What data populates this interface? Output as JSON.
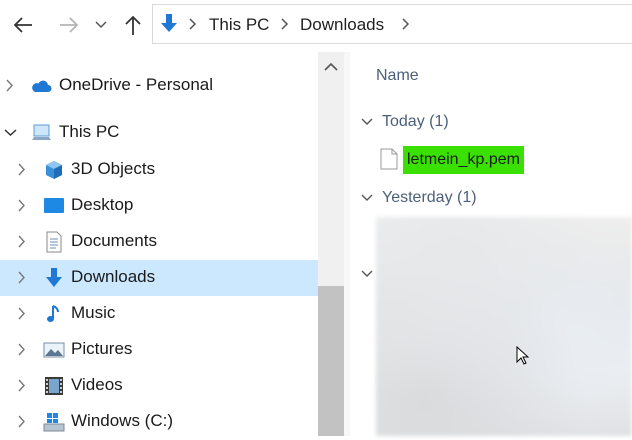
{
  "nav": {
    "back_icon": "arrow-left-icon",
    "forward_icon": "arrow-right-icon",
    "recent_icon": "chevron-down-icon",
    "up_icon": "arrow-up-icon"
  },
  "address": {
    "location_icon": "download-arrow-icon",
    "crumbs": [
      "This PC",
      "Downloads"
    ]
  },
  "tree": {
    "items": [
      {
        "label": "OneDrive - Personal",
        "icon": "cloud-icon"
      },
      {
        "label": "This PC",
        "icon": "computer-icon"
      },
      {
        "label": "3D Objects",
        "icon": "cube-icon"
      },
      {
        "label": "Desktop",
        "icon": "desktop-folder-icon"
      },
      {
        "label": "Documents",
        "icon": "document-icon"
      },
      {
        "label": "Downloads",
        "icon": "download-arrow-icon"
      },
      {
        "label": "Music",
        "icon": "music-note-icon"
      },
      {
        "label": "Pictures",
        "icon": "pictures-icon"
      },
      {
        "label": "Videos",
        "icon": "film-icon"
      },
      {
        "label": "Windows (C:)",
        "icon": "drive-icon"
      }
    ],
    "selected": "Downloads"
  },
  "content": {
    "column_header": "Name",
    "groups": [
      {
        "label": "Today (1)"
      },
      {
        "label": "Yesterday (1)"
      }
    ],
    "files": [
      {
        "name": "letmein_kp.pem",
        "icon": "file-icon",
        "highlight": "#39e000"
      }
    ]
  },
  "colors": {
    "selection": "#cce8ff",
    "accent": "#1e78d4",
    "group_text": "#4c607a"
  }
}
